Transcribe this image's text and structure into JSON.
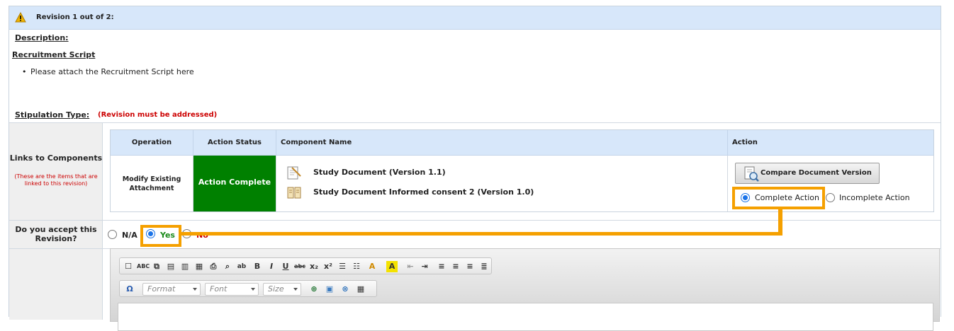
{
  "revision": {
    "title": "Revision 1 out of 2:",
    "description_label": "Description:",
    "recruitment_title": "Recruitment Script",
    "bullet": "Please attach the Recruitment Script here",
    "stipulation_label": "Stipulation Type:",
    "stipulation_value": "(Revision must be addressed)"
  },
  "links": {
    "title": "Links to Components",
    "subtitle": "(These are the items that are linked to this revision)"
  },
  "table": {
    "headers": [
      "Operation",
      "Action Status",
      "Component Name",
      "Action"
    ],
    "operation": "Modify Existing Attachment",
    "status": "Action Complete",
    "components": [
      "Study Document   (Version 1.1)",
      "Study Document Informed consent 2  (Version 1.0)"
    ],
    "compare_button": "Compare Document Version",
    "complete_option": "Complete Action",
    "incomplete_option": "Incomplete Action"
  },
  "accept": {
    "label": "Do you accept this Revision?",
    "na": "N/A",
    "yes": "Yes",
    "no": "No"
  },
  "editor": {
    "format_placeholder": "Format",
    "font_placeholder": "Font",
    "size_placeholder": "Size"
  },
  "colors": {
    "header_blue": "#d7e7fa",
    "status_green": "#008000",
    "highlight_orange": "#f5a000",
    "alert_red": "#cc0000"
  }
}
